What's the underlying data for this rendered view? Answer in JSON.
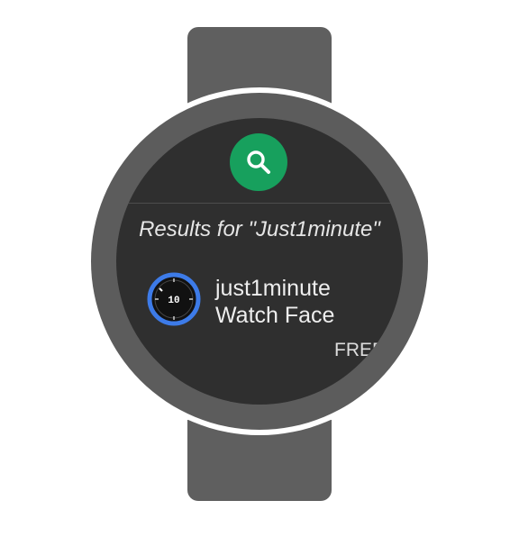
{
  "search": {
    "icon": "search-icon",
    "button_color": "#17a05d"
  },
  "results": {
    "title": "Results for \"Just1minute\"",
    "items": [
      {
        "name_line1": "just1minute",
        "name_line2": "Watch Face",
        "price": "FREE",
        "icon": "watch-face-icon",
        "icon_label": "10",
        "icon_ring_color": "#3d7be8"
      }
    ]
  }
}
